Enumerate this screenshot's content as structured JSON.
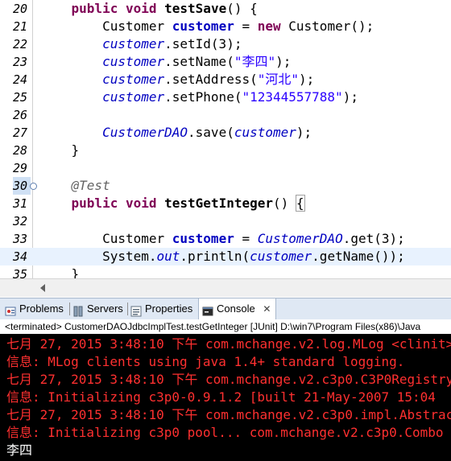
{
  "editor": {
    "lines": [
      {
        "num": "20",
        "tokens": [
          [
            "ws",
            "    "
          ],
          [
            "kw",
            "public"
          ],
          [
            "ws",
            " "
          ],
          [
            "kw",
            "void"
          ],
          [
            "ws",
            " "
          ],
          [
            "bold",
            "testSave"
          ],
          [
            "plain",
            "() {"
          ]
        ]
      },
      {
        "num": "21",
        "tokens": [
          [
            "ws",
            "        "
          ],
          [
            "plain",
            "Customer "
          ],
          [
            "var",
            "customer"
          ],
          [
            "plain",
            " = "
          ],
          [
            "kw",
            "new"
          ],
          [
            "plain",
            " Customer();"
          ]
        ]
      },
      {
        "num": "22",
        "tokens": [
          [
            "ws",
            "        "
          ],
          [
            "fld",
            "customer"
          ],
          [
            "plain",
            ".setId(3);"
          ]
        ]
      },
      {
        "num": "23",
        "tokens": [
          [
            "ws",
            "        "
          ],
          [
            "fld",
            "customer"
          ],
          [
            "plain",
            ".setName("
          ],
          [
            "str",
            "\"李四\""
          ],
          [
            "plain",
            ");"
          ]
        ]
      },
      {
        "num": "24",
        "tokens": [
          [
            "ws",
            "        "
          ],
          [
            "fld",
            "customer"
          ],
          [
            "plain",
            ".setAddress("
          ],
          [
            "str",
            "\"河北\""
          ],
          [
            "plain",
            ");"
          ]
        ]
      },
      {
        "num": "25",
        "tokens": [
          [
            "ws",
            "        "
          ],
          [
            "fld",
            "customer"
          ],
          [
            "plain",
            ".setPhone("
          ],
          [
            "str",
            "\"12344557788\""
          ],
          [
            "plain",
            ");"
          ]
        ]
      },
      {
        "num": "26",
        "tokens": []
      },
      {
        "num": "27",
        "tokens": [
          [
            "ws",
            "        "
          ],
          [
            "fld",
            "CustomerDAO"
          ],
          [
            "plain",
            ".save("
          ],
          [
            "fld",
            "customer"
          ],
          [
            "plain",
            ");"
          ]
        ]
      },
      {
        "num": "28",
        "tokens": [
          [
            "ws",
            "    "
          ],
          [
            "plain",
            "}"
          ]
        ]
      },
      {
        "num": "29",
        "tokens": []
      },
      {
        "num": "30",
        "tokens": [
          [
            "ws",
            "    "
          ],
          [
            "ann",
            "@Test"
          ]
        ]
      },
      {
        "num": "31",
        "tokens": [
          [
            "ws",
            "    "
          ],
          [
            "kw",
            "public"
          ],
          [
            "ws",
            " "
          ],
          [
            "kw",
            "void"
          ],
          [
            "ws",
            " "
          ],
          [
            "bold",
            "testGetInteger"
          ],
          [
            "plain",
            "() "
          ],
          [
            "box",
            "{"
          ]
        ]
      },
      {
        "num": "32",
        "tokens": []
      },
      {
        "num": "33",
        "tokens": [
          [
            "ws",
            "        "
          ],
          [
            "plain",
            "Customer "
          ],
          [
            "var",
            "customer"
          ],
          [
            "plain",
            " = "
          ],
          [
            "fld",
            "CustomerDAO"
          ],
          [
            "plain",
            ".get(3);"
          ]
        ]
      },
      {
        "num": "34",
        "tokens": [
          [
            "ws",
            "        "
          ],
          [
            "plain",
            "System."
          ],
          [
            "fld",
            "out"
          ],
          [
            "plain",
            ".println("
          ],
          [
            "fld",
            "customer"
          ],
          [
            "plain",
            ".getName());"
          ]
        ]
      },
      {
        "num": "35",
        "tokens": [
          [
            "ws",
            "    "
          ],
          [
            "plain",
            "}"
          ]
        ]
      }
    ]
  },
  "view_tabs": {
    "problems": "Problems",
    "servers": "Servers",
    "properties": "Properties",
    "console": "Console",
    "close_symbol": "✕"
  },
  "console_header": "<terminated> CustomerDAOJdbcImplTest.testGetInteger [JUnit] D:\\win7\\Program Files(x86)\\Java",
  "console_lines": [
    {
      "type": "err",
      "text": "七月 27, 2015 3:48:10 下午 com.mchange.v2.log.MLog <clinit>"
    },
    {
      "type": "err",
      "text": "信息: MLog clients using java 1.4+ standard logging."
    },
    {
      "type": "err",
      "text": "七月 27, 2015 3:48:10 下午 com.mchange.v2.c3p0.C3P0Registry"
    },
    {
      "type": "err",
      "text": "信息: Initializing c3p0-0.9.1.2 [built 21-May-2007 15:04"
    },
    {
      "type": "err",
      "text": "七月 27, 2015 3:48:10 下午 com.mchange.v2.c3p0.impl.Abstrac"
    },
    {
      "type": "err",
      "text": "信息: Initializing c3p0 pool... com.mchange.v2.c3p0.Combo"
    },
    {
      "type": "out",
      "text": "李四"
    }
  ],
  "colors": {
    "keyword": "#7f0055",
    "field": "#0000c0",
    "string": "#2a00ff",
    "stderr": "#ff3030",
    "console_bg": "#000000"
  }
}
